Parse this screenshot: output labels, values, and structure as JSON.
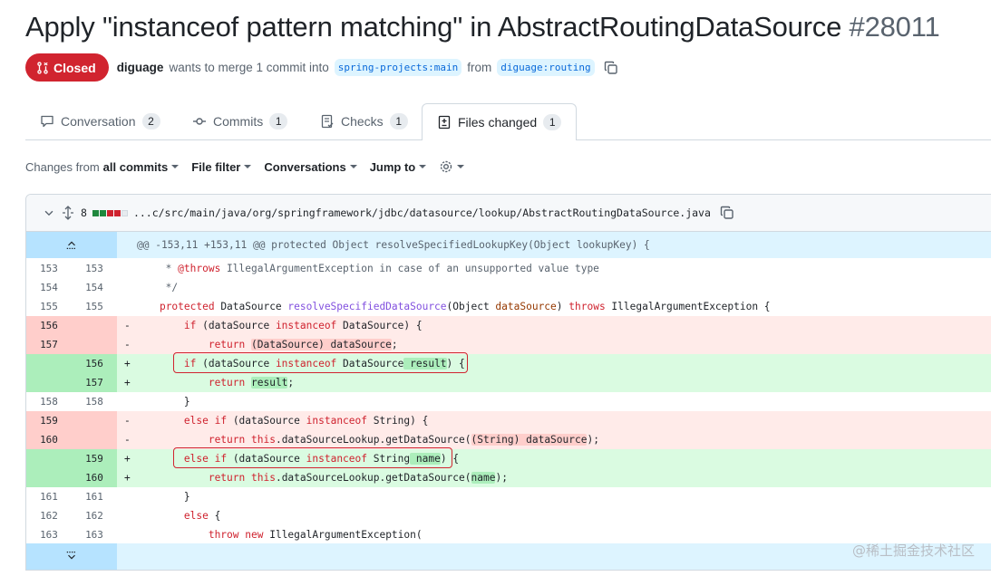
{
  "title": "Apply \"instanceof pattern matching\" in AbstractRoutingDataSource",
  "pr_number": "#28011",
  "status": "Closed",
  "author": "diguage",
  "merge_text": "wants to merge 1 commit into",
  "base_branch": "spring-projects:main",
  "from_text": "from",
  "head_branch": "diguage:routing",
  "tabs": [
    {
      "label": "Conversation",
      "count": "2"
    },
    {
      "label": "Commits",
      "count": "1"
    },
    {
      "label": "Checks",
      "count": "1"
    },
    {
      "label": "Files changed",
      "count": "1"
    }
  ],
  "toolbar": {
    "changes_from": "Changes from",
    "all_commits": "all commits",
    "file_filter": "File filter",
    "conversations": "Conversations",
    "jump_to": "Jump to"
  },
  "file": {
    "changes": "8",
    "path": "...c/src/main/java/org/springframework/jdbc/datasource/lookup/AbstractRoutingDataSource.java",
    "hunk": "@@ -153,11 +153,11 @@ protected Object resolveSpecifiedLookupKey(Object lookupKey) {"
  },
  "diff_lines": [
    {
      "type": "ctx",
      "old": "153",
      "new": "153",
      "marker": "",
      "code": "\t * @throws IllegalArgumentException in case of an unsupported value type"
    },
    {
      "type": "ctx",
      "old": "154",
      "new": "154",
      "marker": "",
      "code": "\t */"
    },
    {
      "type": "ctx",
      "old": "155",
      "new": "155",
      "marker": "",
      "code": "\tprotected DataSource resolveSpecifiedDataSource(Object dataSource) throws IllegalArgumentException {"
    },
    {
      "type": "del",
      "old": "156",
      "new": "",
      "marker": "-",
      "code": "\t\tif (dataSource instanceof DataSource) {"
    },
    {
      "type": "del",
      "old": "157",
      "new": "",
      "marker": "-",
      "code": "\t\t\treturn (DataSource) dataSource;"
    },
    {
      "type": "add",
      "old": "",
      "new": "156",
      "marker": "+",
      "code": "\t\tif (dataSource instanceof DataSource result) {"
    },
    {
      "type": "add",
      "old": "",
      "new": "157",
      "marker": "+",
      "code": "\t\t\treturn result;"
    },
    {
      "type": "ctx",
      "old": "158",
      "new": "158",
      "marker": "",
      "code": "\t\t}"
    },
    {
      "type": "del",
      "old": "159",
      "new": "",
      "marker": "-",
      "code": "\t\telse if (dataSource instanceof String) {"
    },
    {
      "type": "del",
      "old": "160",
      "new": "",
      "marker": "-",
      "code": "\t\t\treturn this.dataSourceLookup.getDataSource((String) dataSource);"
    },
    {
      "type": "add",
      "old": "",
      "new": "159",
      "marker": "+",
      "code": "\t\telse if (dataSource instanceof String name) {"
    },
    {
      "type": "add",
      "old": "",
      "new": "160",
      "marker": "+",
      "code": "\t\t\treturn this.dataSourceLookup.getDataSource(name);"
    },
    {
      "type": "ctx",
      "old": "161",
      "new": "161",
      "marker": "",
      "code": "\t\t}"
    },
    {
      "type": "ctx",
      "old": "162",
      "new": "162",
      "marker": "",
      "code": "\t\telse {"
    },
    {
      "type": "ctx",
      "old": "163",
      "new": "163",
      "marker": "",
      "code": "\t\t\tthrow new IllegalArgumentException("
    }
  ],
  "watermark": "@稀土掘金技术社区",
  "colors": {
    "closed": "#d1242f",
    "added": "#dafbe1",
    "deleted": "#ffebe9",
    "hunk": "#ddf4ff"
  }
}
